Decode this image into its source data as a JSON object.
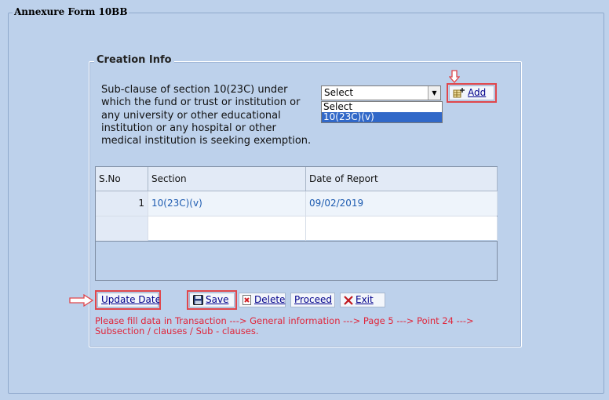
{
  "window": {
    "title": "Annexure Form 10BB"
  },
  "creation_info": {
    "legend": "Creation Info",
    "subclause_label": "Sub-clause of section 10(23C) under which the fund or trust or institution or any university or other educational institution or any hospital or other medical institution is seeking exemption.",
    "select": {
      "value": "Select",
      "options": [
        "Select",
        "10(23C)(v)"
      ],
      "highlighted_option": "10(23C)(v)"
    },
    "add_label": "Add"
  },
  "grid": {
    "columns": [
      "S.No",
      "Section",
      "Date of Report"
    ],
    "rows": [
      {
        "sno": "1",
        "section": "10(23C)(v)",
        "date": "09/02/2019"
      },
      {
        "sno": "",
        "section": "",
        "date": ""
      }
    ]
  },
  "buttons": {
    "update_date": "Update Date",
    "save": "Save",
    "delete": "Delete",
    "proceed": "Proceed",
    "exit": "Exit"
  },
  "note": "Please fill data in Transaction ---> General information ---> Page 5  ---> Point 24 ---> Subsection / clauses / Sub - clauses.",
  "colors": {
    "background": "#bdd1eb",
    "highlight": "#e0464b",
    "note_text": "#e0253a",
    "link_text": "#1d5bb0",
    "selected_option": "#3168c8"
  }
}
